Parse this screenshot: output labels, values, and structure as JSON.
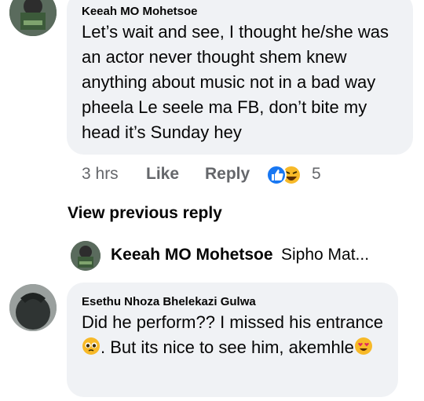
{
  "comment1": {
    "author": "Keeah MO Mohetsoe",
    "text": "Let’s wait and see, I thought he/she was an actor never thought shem knew anything about music not in a bad way pheela Le seele ma FB, don’t bite my head it’s Sunday hey",
    "time": "3 hrs",
    "like_label": "Like",
    "reply_label": "Reply",
    "reaction_count": "5",
    "reaction_icons": [
      "like-reaction-icon",
      "haha-reaction-icon"
    ]
  },
  "view_previous": "View previous reply",
  "reply_preview": {
    "author": "Keeah MO Mohetsoe",
    "snippet": "Sipho Mat..."
  },
  "comment2": {
    "author": "Esethu Nhoza Bhelekazi Gulwa",
    "text_part1": "Did he perform?? I missed his entrance",
    "text_part2": ". But its nice to see him, akemhle",
    "emoji1": "pleading-face-icon",
    "emoji2": "heart-eyes-icon"
  },
  "colors": {
    "bubble_bg": "#f0f2f5",
    "meta_gray": "#65676b",
    "like_blue": "#1877f2",
    "haha_yellow": "#f7b928"
  }
}
